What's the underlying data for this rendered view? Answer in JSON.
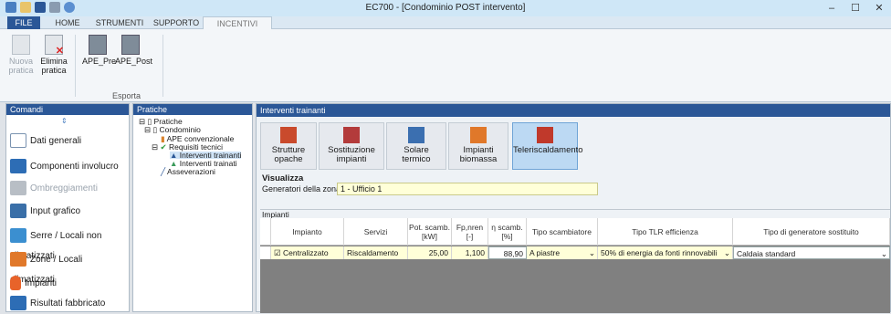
{
  "app": {
    "title": "EC700 - [Condominio POST intervento]"
  },
  "ribbon": {
    "tabs": [
      "FILE",
      "HOME",
      "STRUMENTI",
      "SUPPORTO",
      "INCENTIVI FISCALI"
    ],
    "buttons": [
      {
        "label1": "Nuova",
        "label2": "pratica"
      },
      {
        "label1": "Elimina",
        "label2": "pratica"
      },
      {
        "label1": "APE_Pre",
        "label2": ""
      },
      {
        "label1": "APE_Post",
        "label2": ""
      }
    ],
    "group_label": "Esporta"
  },
  "comandi": {
    "title": "Comandi",
    "items": [
      "Dati generali",
      "Componenti involucro",
      "Ombreggiamenti",
      "Input grafico",
      "Serre / Locali non climatizzati",
      "Zone / Locali climatizzati",
      "Impianti",
      "Risultati fabbricato"
    ]
  },
  "pratiche": {
    "title": "Pratiche",
    "tree": [
      "Pratiche",
      "Condominio",
      "APE convenzionale",
      "Requisiti tecnici",
      "Interventi trainanti",
      "Interventi trainati",
      "Asseverazioni"
    ]
  },
  "main": {
    "title": "Interventi trainanti",
    "options": [
      {
        "l1": "Strutture",
        "l2": "opache"
      },
      {
        "l1": "Sostituzione",
        "l2": "impianti"
      },
      {
        "l1": "Solare",
        "l2": "termico"
      },
      {
        "l1": "Impianti",
        "l2": "biomassa"
      },
      {
        "l1": "Teleriscaldamento",
        "l2": ""
      }
    ],
    "visualizza": "Visualizza",
    "gen_label": "Generatori della zona",
    "gen_value": "1 - Ufficio 1",
    "impianti_label": "Impianti",
    "columns": [
      "Impianto",
      "Servizi",
      "Pot. scamb. [kW]",
      "Fp,nren [-]",
      "η scamb. [%]",
      "Tipo scambiatore",
      "Tipo TLR efficienza",
      "Tipo di generatore sostituito"
    ],
    "row": {
      "impianto": "Centralizzato",
      "servizi": "Riscaldamento",
      "pot": "25,00",
      "fp": "1,100",
      "eta": "88,90",
      "scambiatore": "A piastre",
      "tlr": "50% di energia da fonti rinnovabili",
      "generatore": "Caldaia standard"
    }
  }
}
